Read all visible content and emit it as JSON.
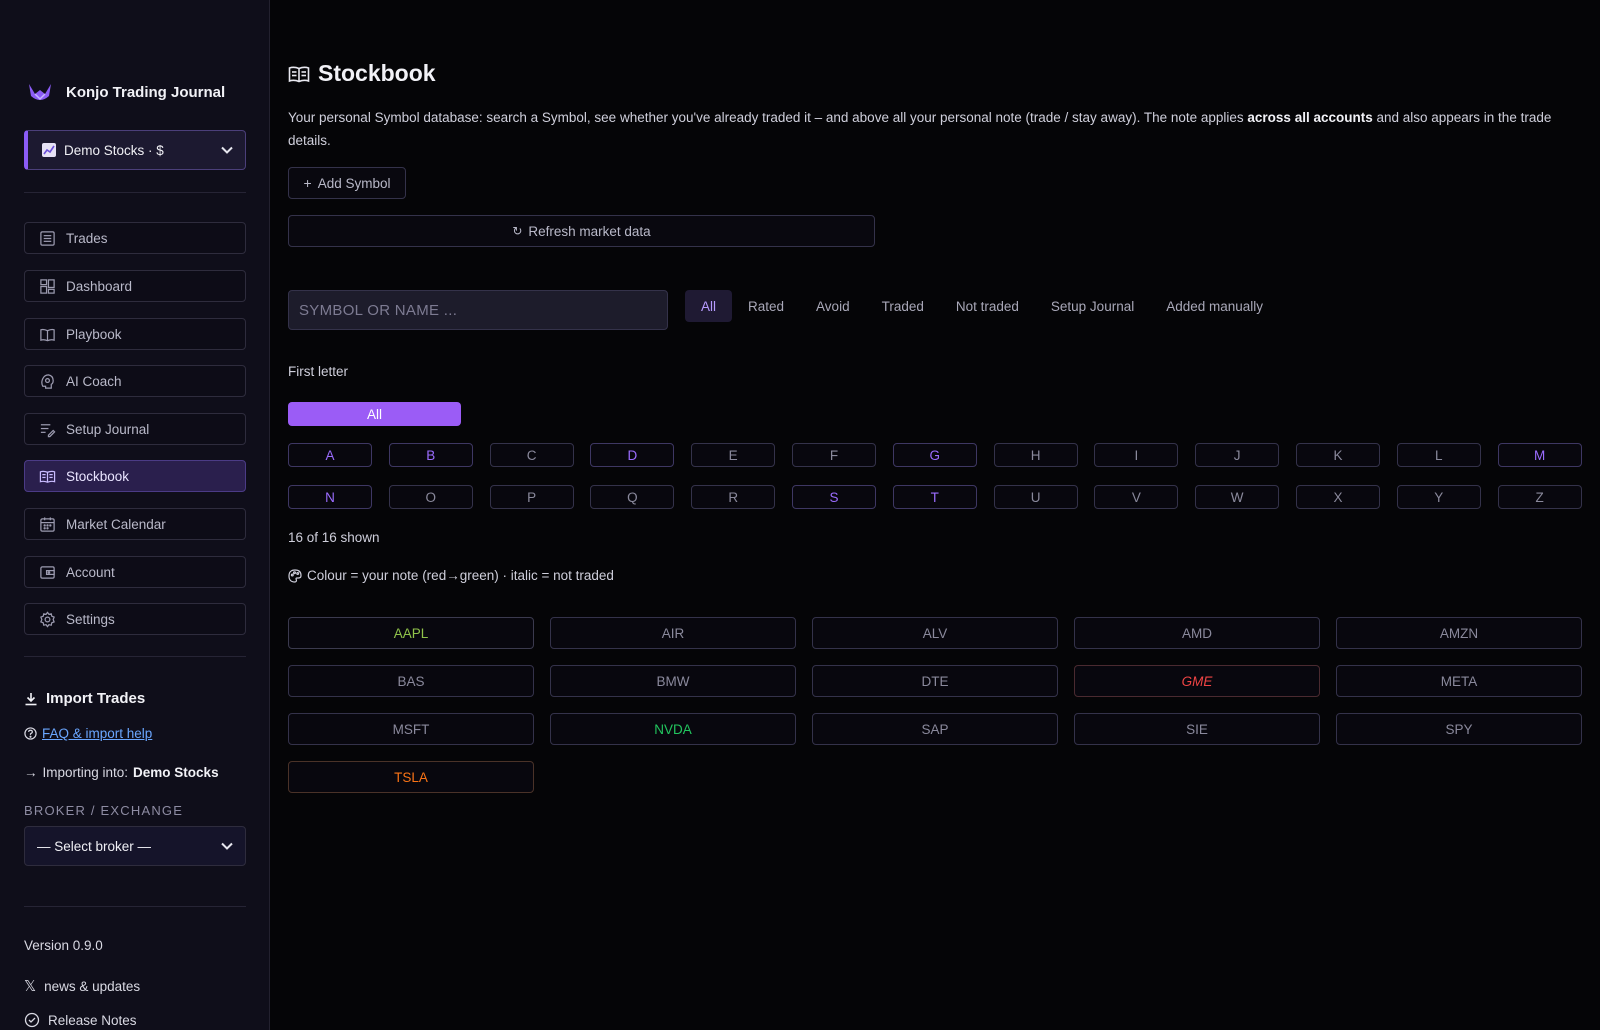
{
  "sidebar": {
    "brand": "Konjo Trading Journal",
    "account": "Demo Stocks · $",
    "nav": [
      {
        "label": "Trades",
        "icon": "list-icon"
      },
      {
        "label": "Dashboard",
        "icon": "dashboard-icon"
      },
      {
        "label": "Playbook",
        "icon": "book-open-icon"
      },
      {
        "label": "AI Coach",
        "icon": "brain-icon"
      },
      {
        "label": "Setup Journal",
        "icon": "notes-icon"
      },
      {
        "label": "Stockbook",
        "icon": "book-icon",
        "active": true
      },
      {
        "label": "Market Calendar",
        "icon": "calendar-icon"
      },
      {
        "label": "Account",
        "icon": "wallet-icon"
      },
      {
        "label": "Settings",
        "icon": "gear-icon"
      }
    ],
    "import_title": "Import Trades",
    "faq_link": "FAQ & import help",
    "importing_prefix": "Importing into:",
    "importing_account": "Demo Stocks",
    "broker_label": "BROKER / EXCHANGE",
    "broker_select": "— Select broker —",
    "version": "Version 0.9.0",
    "news": "news & updates",
    "release_notes": "Release Notes"
  },
  "main": {
    "title": "Stockbook",
    "desc_part1": "Your personal Symbol database: search a Symbol, see whether you've already traded it – and above all your personal note (trade / stay away). The note applies ",
    "desc_bold": "across all accounts",
    "desc_part2": " and also appears in the trade details.",
    "add_symbol": "Add Symbol",
    "refresh": "Refresh market data",
    "search_placeholder": "SYMBOL OR NAME ...",
    "filters": [
      "All",
      "Rated",
      "Avoid",
      "Traded",
      "Not traded",
      "Setup Journal",
      "Added manually"
    ],
    "active_filter": 0,
    "first_letter_label": "First letter",
    "all_letters": "All",
    "letters": [
      "A",
      "B",
      "C",
      "D",
      "E",
      "F",
      "G",
      "H",
      "I",
      "J",
      "K",
      "L",
      "M",
      "N",
      "O",
      "P",
      "Q",
      "R",
      "S",
      "T",
      "U",
      "V",
      "W",
      "X",
      "Y",
      "Z"
    ],
    "letters_with_symbols": [
      "A",
      "B",
      "D",
      "G",
      "M",
      "N",
      "S",
      "T"
    ],
    "shown": "16 of 16 shown",
    "legend": "Colour = your note (red→green) · italic = not traded",
    "symbols": [
      {
        "ticker": "AAPL",
        "color": "#8fc24a",
        "border": "#3b3a4e",
        "italic": false
      },
      {
        "ticker": "AIR",
        "color": "#8a899c",
        "border": "#34324a",
        "italic": false
      },
      {
        "ticker": "ALV",
        "color": "#8a899c",
        "border": "#34324a",
        "italic": false
      },
      {
        "ticker": "AMD",
        "color": "#8a899c",
        "border": "#34324a",
        "italic": false
      },
      {
        "ticker": "AMZN",
        "color": "#8a899c",
        "border": "#34324a",
        "italic": false
      },
      {
        "ticker": "BAS",
        "color": "#8a899c",
        "border": "#34324a",
        "italic": false
      },
      {
        "ticker": "BMW",
        "color": "#8a899c",
        "border": "#34324a",
        "italic": false
      },
      {
        "ticker": "DTE",
        "color": "#8a899c",
        "border": "#34324a",
        "italic": false
      },
      {
        "ticker": "GME",
        "color": "#ef4444",
        "border": "#4a2a30",
        "italic": true
      },
      {
        "ticker": "META",
        "color": "#8a899c",
        "border": "#34324a",
        "italic": false
      },
      {
        "ticker": "MSFT",
        "color": "#8a899c",
        "border": "#34324a",
        "italic": false
      },
      {
        "ticker": "NVDA",
        "color": "#22c55e",
        "border": "#34324a",
        "italic": false
      },
      {
        "ticker": "SAP",
        "color": "#8a899c",
        "border": "#34324a",
        "italic": false
      },
      {
        "ticker": "SIE",
        "color": "#8a899c",
        "border": "#34324a",
        "italic": false
      },
      {
        "ticker": "SPY",
        "color": "#8a899c",
        "border": "#34324a",
        "italic": false
      },
      {
        "ticker": "TSLA",
        "color": "#f97316",
        "border": "#4a3228",
        "italic": false
      }
    ]
  },
  "colors": {
    "accent": "#9b5cf6",
    "background": "#050507",
    "sidebar": "#0f0e1a"
  }
}
